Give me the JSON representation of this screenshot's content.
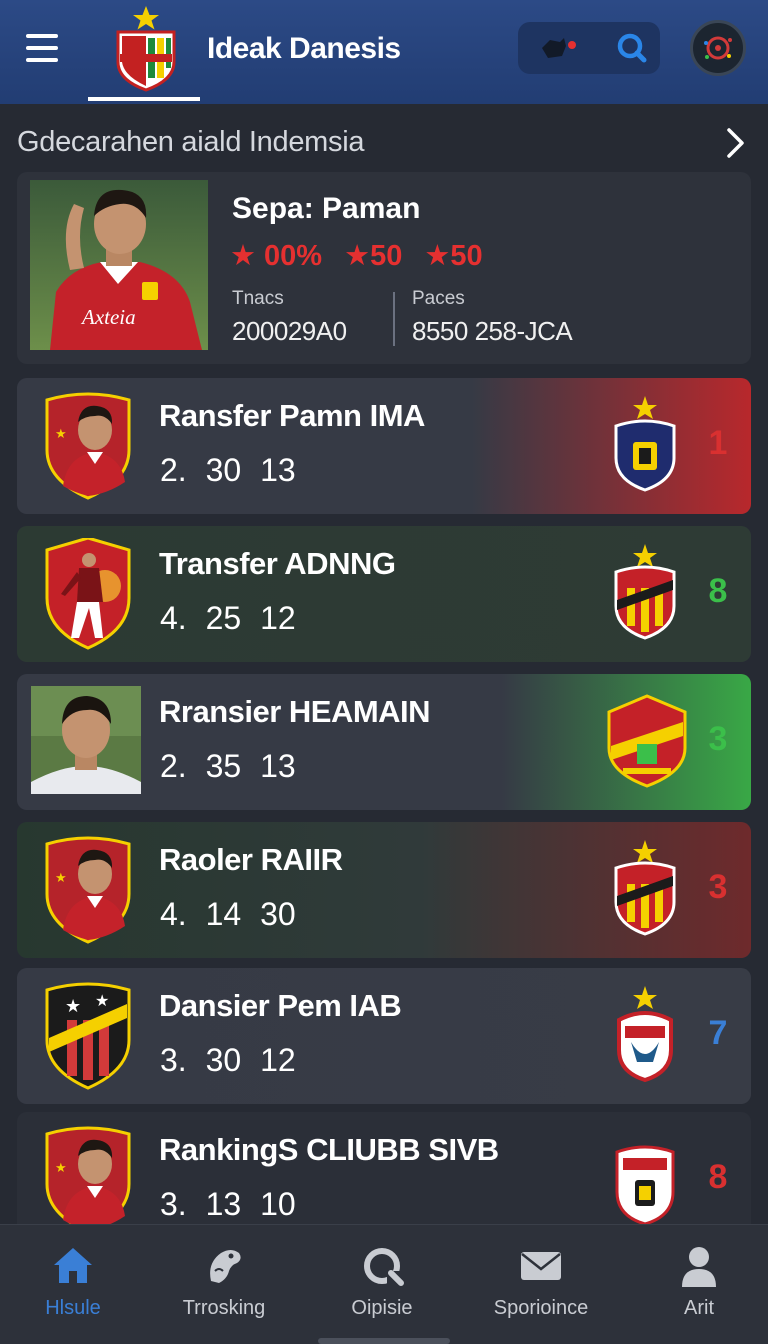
{
  "header": {
    "app_title": "Ideak Danesis"
  },
  "featured": {
    "section_title": "Gdecarahen aiald Indemsia",
    "player_name": "Sepa: Paman",
    "ratings": [
      "★ 00%",
      "★50",
      "★50"
    ],
    "stats": [
      {
        "label": "Tnacs",
        "value": "200029A0"
      },
      {
        "label": "Paces",
        "value": "8550 258-JCA"
      }
    ],
    "jersey_text": "Axteia"
  },
  "rankings": [
    {
      "name": "Ransfer Pamn IMA",
      "stats": "2. 30 13",
      "value": "1",
      "value_color": "#d93030",
      "bg": "linear-gradient(90deg, #363a45 0%, #363a45 62%, #b8282c 100%)",
      "thumb": "crest-red",
      "badge": "navy"
    },
    {
      "name": "Transfer ADNNG",
      "stats": "4. 25 12",
      "value": "8",
      "value_color": "#3bbf4a",
      "bg": "linear-gradient(90deg, #2c3a33 0%, #2e3b35 100%)",
      "thumb": "crest-red-player",
      "badge": "red-yellow"
    },
    {
      "name": "Rransier HEAMAIN",
      "stats": "2. 35 13",
      "value": "3",
      "value_color": "#3bbf4a",
      "bg": "linear-gradient(90deg, #363a45 0%, #363a45 66%, #39a846 100%)",
      "thumb": "photo",
      "badge": "shield-red"
    },
    {
      "name": "Raoler RAIIR",
      "stats": "4. 14 30",
      "value": "3",
      "value_color": "#d93030",
      "bg": "linear-gradient(90deg, #27382f 0%, #303a3a 55%, #6e2a2c 100%)",
      "thumb": "crest-red",
      "badge": "red-yellow"
    },
    {
      "name": "Dansier Pem IAB",
      "stats": "3. 30 12",
      "value": "7",
      "value_color": "#3a7fd6",
      "bg": "linear-gradient(90deg, #363a45 0%, #383c46 100%)",
      "thumb": "crest-black",
      "badge": "white-red"
    },
    {
      "name": "RankingS CLIUBB SIVB",
      "stats": "3. 13 10",
      "value": "8",
      "value_color": "#d93030",
      "bg": "linear-gradient(90deg, #2b2f38 0%, #2b2f38 100%)",
      "thumb": "crest-red",
      "badge": "white-shield"
    }
  ],
  "bottom_nav": [
    {
      "label": "Hlsule",
      "icon": "home-icon",
      "active": true
    },
    {
      "label": "Trrosking",
      "icon": "dragon-icon",
      "active": false
    },
    {
      "label": "Oipisie",
      "icon": "refresh-icon",
      "active": false
    },
    {
      "label": "Sporioince",
      "icon": "mail-icon",
      "active": false
    },
    {
      "label": "Arit",
      "icon": "user-icon",
      "active": false
    }
  ],
  "colors": {
    "accent_blue": "#3a7fd6",
    "accent_red": "#e53030",
    "accent_green": "#3bbf4a",
    "header_bg": "#2c4a86",
    "page_bg": "#262a33"
  }
}
